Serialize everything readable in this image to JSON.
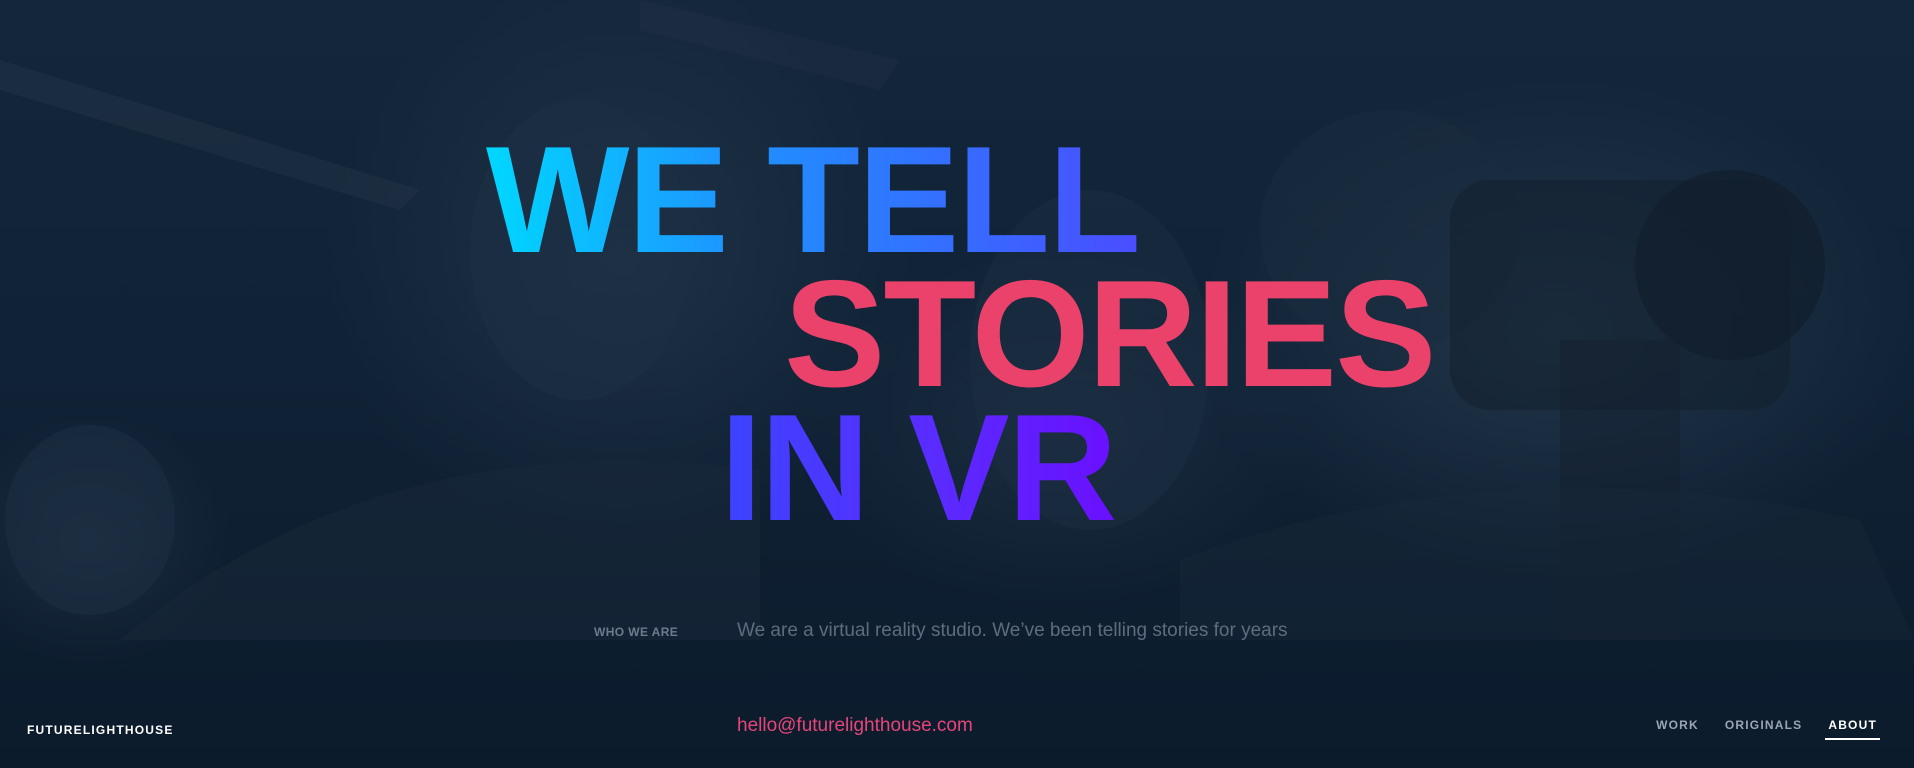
{
  "hero": {
    "line1": "WE TELL",
    "line2": "STORIES",
    "line3": "IN VR"
  },
  "intro": {
    "label": "WHO WE ARE",
    "text": "We are a virtual reality studio. We’ve been telling stories for years"
  },
  "footer": {
    "brand": "FUTURELIGHTHOUSE",
    "email": "hello@futurelighthouse.com"
  },
  "nav": {
    "items": [
      {
        "label": "WORK",
        "active": false
      },
      {
        "label": "ORIGINALS",
        "active": false
      },
      {
        "label": "ABOUT",
        "active": true
      }
    ]
  },
  "colors": {
    "background": "#0b1b2c",
    "line1_gradient_start": "#00d7ff",
    "line1_gradient_end": "#4a4dff",
    "line2": "#ea426b",
    "line3_gradient_start": "#3c44ff",
    "line3_gradient_end": "#6a10ff",
    "email": "#e6457a",
    "nav_active": "#ffffff",
    "nav_inactive": "#9aa6b3"
  }
}
